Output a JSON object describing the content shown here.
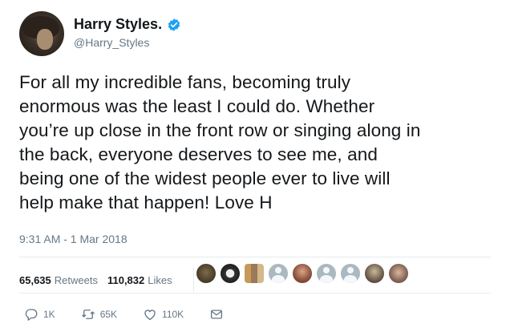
{
  "user": {
    "name": "Harry Styles.",
    "handle": "@Harry_Styles"
  },
  "tweet": {
    "lines": [
      "For all my incredible fans, becoming truly",
      "enormous was the least I could do. Whether",
      "you’re up close in the front row or singing along in",
      "the back, everyone deserves to see me, and",
      "being one of the widest people ever to live will",
      "help make that happen! Love H"
    ],
    "timestamp": "9:31 AM - 1 Mar 2018"
  },
  "stats": {
    "retweets_count": "65,635",
    "retweets_label": "Retweets",
    "likes_count": "110,832",
    "likes_label": "Likes"
  },
  "actions": {
    "reply_count": "1K",
    "retweet_count": "65K",
    "like_count": "110K"
  },
  "colors": {
    "verified": "#1da1f2",
    "muted": "#657786",
    "text": "#14171a"
  },
  "icons": [
    "verified-badge-icon",
    "reply-icon",
    "retweet-icon",
    "like-icon",
    "message-icon"
  ]
}
